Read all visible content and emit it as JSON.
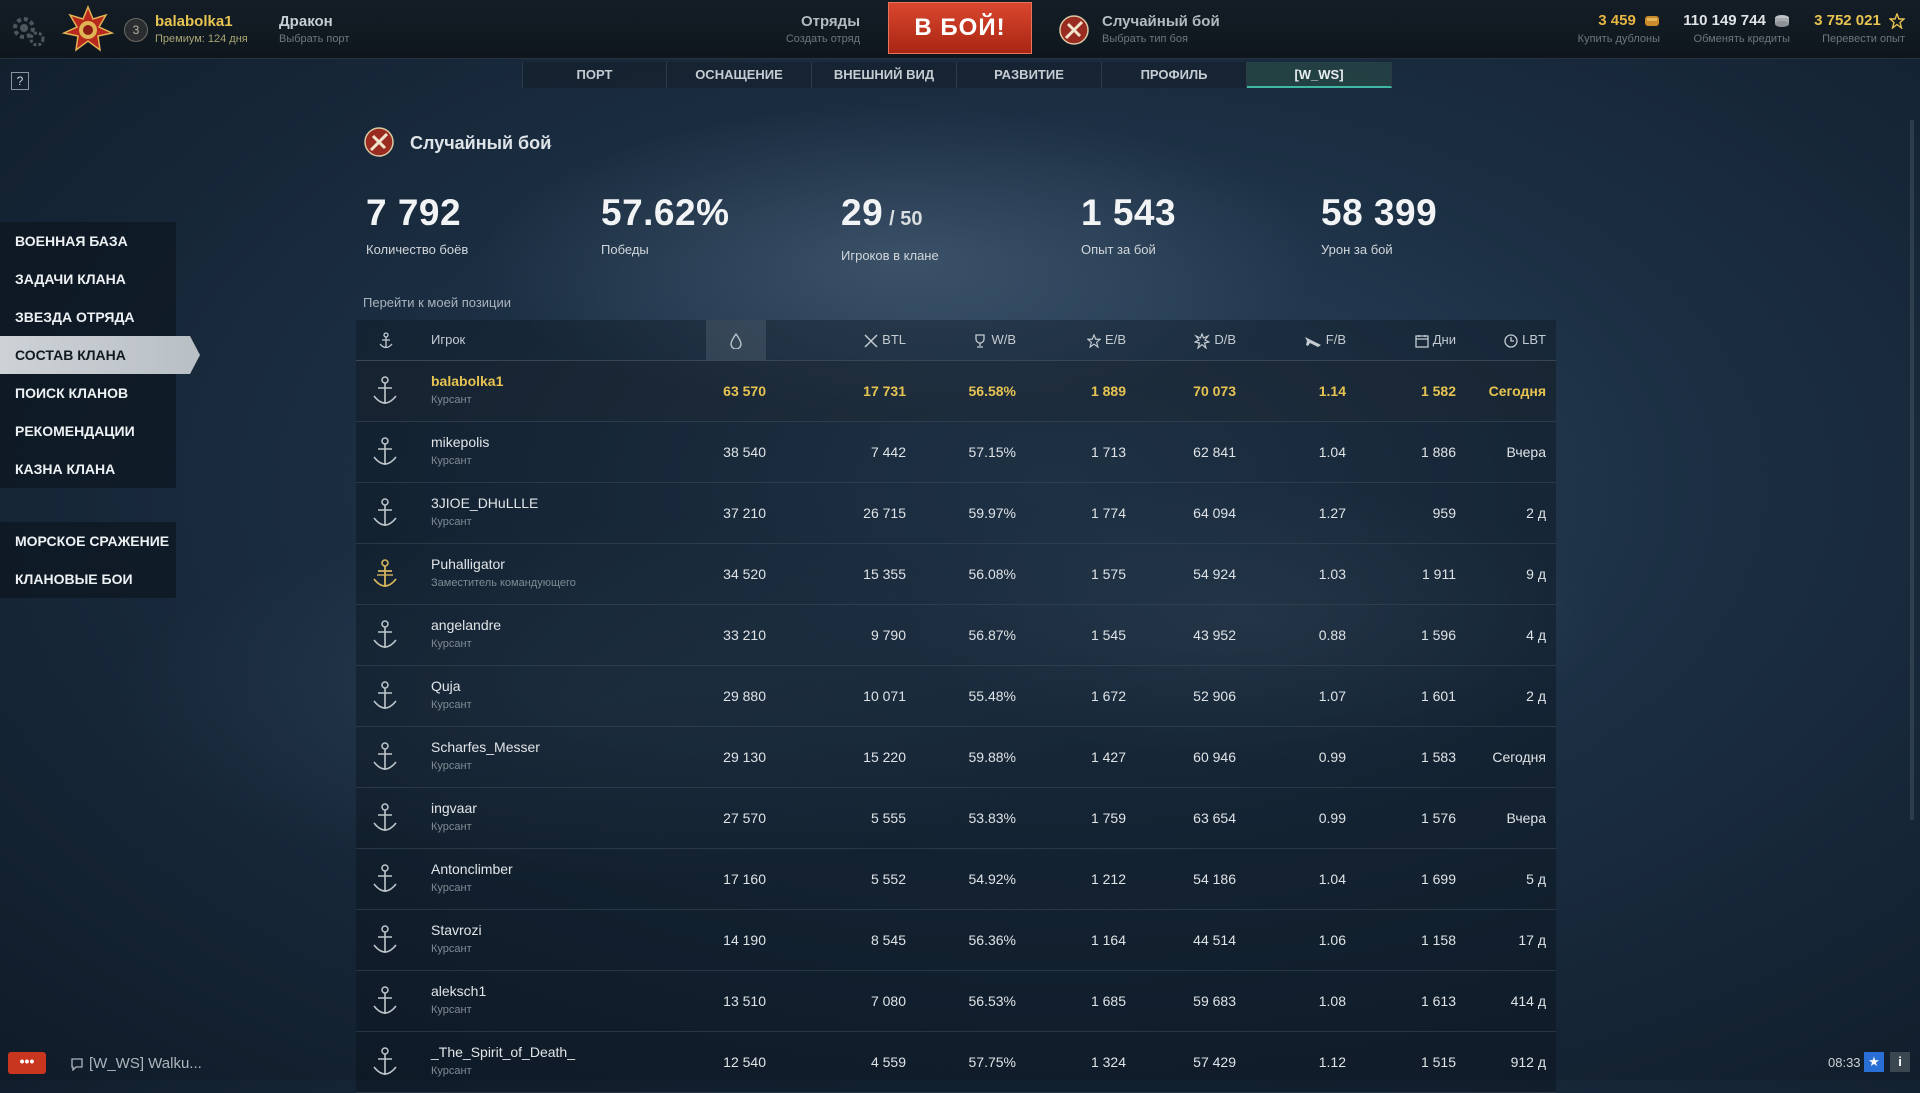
{
  "topbar": {
    "username": "balabolka1",
    "premium": "Премиум: 124 дня",
    "level": "3",
    "ship_name": "Дракон",
    "ship_sub": "Выбрать порт",
    "squad_label": "Отряды",
    "squad_sub": "Создать отряд",
    "battle_label": "В БОЙ!",
    "mode_label": "Случайный бой",
    "mode_sub": "Выбрать тип боя",
    "currencies": [
      {
        "value": "3 459",
        "label": "Купить дублоны",
        "color": "#e7b544",
        "icon": "doubloon-icon"
      },
      {
        "value": "110 149 744",
        "label": "Обменять кредиты",
        "color": "#dfe3e6",
        "icon": "credits-icon"
      },
      {
        "value": "3 752 021",
        "label": "Перевести опыт",
        "color": "#e7c452",
        "icon": "star-icon"
      }
    ]
  },
  "help_label": "?",
  "tabs": [
    {
      "label": "ПОРТ",
      "active": false
    },
    {
      "label": "ОСНАЩЕНИЕ",
      "active": false
    },
    {
      "label": "ВНЕШНИЙ ВИД",
      "active": false
    },
    {
      "label": "РАЗВИТИЕ",
      "active": false
    },
    {
      "label": "ПРОФИЛЬ",
      "active": false
    },
    {
      "label": "[W_WS]",
      "active": true
    }
  ],
  "sidebar": {
    "group1": [
      {
        "label": "ВОЕННАЯ БАЗА",
        "active": false
      },
      {
        "label": "ЗАДАЧИ КЛАНА",
        "active": false
      },
      {
        "label": "ЗВЕЗДА ОТРЯДА",
        "active": false
      },
      {
        "label": "СОСТАВ КЛАНА",
        "active": true
      },
      {
        "label": "ПОИСК КЛАНОВ",
        "active": false
      },
      {
        "label": "РЕКОМЕНДАЦИИ",
        "active": false
      },
      {
        "label": "КАЗНА КЛАНА",
        "active": false
      }
    ],
    "group2": [
      {
        "label": "МОРСКОЕ СРАЖЕНИЕ",
        "active": false
      },
      {
        "label": "КЛАНОВЫЕ БОИ",
        "active": false
      }
    ]
  },
  "mode_header": {
    "title": "Случайный бой",
    "arrow": "↓"
  },
  "stats": [
    {
      "value": "7 792",
      "suffix": "",
      "label": "Количество боёв"
    },
    {
      "value": "57.62%",
      "suffix": "",
      "label": "Победы"
    },
    {
      "value": "29",
      "suffix": "/ 50",
      "label": "Игроков в клане"
    },
    {
      "value": "1 543",
      "suffix": "",
      "label": "Опыт за бой"
    },
    {
      "value": "58 399",
      "suffix": "",
      "label": "Урон за бой"
    }
  ],
  "goto_label": "Перейти к моей позиции",
  "table": {
    "columns": [
      {
        "key": "rank",
        "label": "",
        "icon": "anchor-icon"
      },
      {
        "key": "player",
        "label": "Игрок",
        "icon": ""
      },
      {
        "key": "oil",
        "label": "",
        "icon": "oil-drop-icon"
      },
      {
        "key": "btl",
        "label": "BTL",
        "icon": "crossed-swords-icon"
      },
      {
        "key": "wb",
        "label": "W/B",
        "icon": "trophy-icon"
      },
      {
        "key": "eb",
        "label": "E/B",
        "icon": "star-icon"
      },
      {
        "key": "db",
        "label": "D/B",
        "icon": "explosion-icon"
      },
      {
        "key": "fb",
        "label": "F/B",
        "icon": "plane-icon"
      },
      {
        "key": "days",
        "label": "Дни",
        "icon": "calendar-icon"
      },
      {
        "key": "lbt",
        "label": "LBT",
        "icon": "clock-icon"
      }
    ],
    "rows": [
      {
        "name": "balabolka1",
        "role": "Курсант",
        "oil": "63 570",
        "btl": "17 731",
        "wb": "56.58%",
        "eb": "1 889",
        "db": "70 073",
        "fb": "1.14",
        "days": "1 582",
        "lbt": "Сегодня",
        "me": true,
        "officer": false
      },
      {
        "name": "mikepolis",
        "role": "Курсант",
        "oil": "38 540",
        "btl": "7 442",
        "wb": "57.15%",
        "eb": "1 713",
        "db": "62 841",
        "fb": "1.04",
        "days": "1 886",
        "lbt": "Вчера",
        "me": false,
        "officer": false
      },
      {
        "name": "3JIOE_DHuLLLE",
        "role": "Курсант",
        "oil": "37 210",
        "btl": "26 715",
        "wb": "59.97%",
        "eb": "1 774",
        "db": "64 094",
        "fb": "1.27",
        "days": "959",
        "lbt": "2 д",
        "me": false,
        "officer": false
      },
      {
        "name": "Puhalligator",
        "role": "Заместитель командующего",
        "oil": "34 520",
        "btl": "15 355",
        "wb": "56.08%",
        "eb": "1 575",
        "db": "54 924",
        "fb": "1.03",
        "days": "1 911",
        "lbt": "9 д",
        "me": false,
        "officer": true
      },
      {
        "name": "angelandre",
        "role": "Курсант",
        "oil": "33 210",
        "btl": "9 790",
        "wb": "56.87%",
        "eb": "1 545",
        "db": "43 952",
        "fb": "0.88",
        "days": "1 596",
        "lbt": "4 д",
        "me": false,
        "officer": false
      },
      {
        "name": "Quja",
        "role": "Курсант",
        "oil": "29 880",
        "btl": "10 071",
        "wb": "55.48%",
        "eb": "1 672",
        "db": "52 906",
        "fb": "1.07",
        "days": "1 601",
        "lbt": "2 д",
        "me": false,
        "officer": false
      },
      {
        "name": "Scharfes_Messer",
        "role": "Курсант",
        "oil": "29 130",
        "btl": "15 220",
        "wb": "59.88%",
        "eb": "1 427",
        "db": "60 946",
        "fb": "0.99",
        "days": "1 583",
        "lbt": "Сегодня",
        "me": false,
        "officer": false
      },
      {
        "name": "ingvaar",
        "role": "Курсант",
        "oil": "27 570",
        "btl": "5 555",
        "wb": "53.83%",
        "eb": "1 759",
        "db": "63 654",
        "fb": "0.99",
        "days": "1 576",
        "lbt": "Вчера",
        "me": false,
        "officer": false
      },
      {
        "name": "Antonclimber",
        "role": "Курсант",
        "oil": "17 160",
        "btl": "5 552",
        "wb": "54.92%",
        "eb": "1 212",
        "db": "54 186",
        "fb": "1.04",
        "days": "1 699",
        "lbt": "5 д",
        "me": false,
        "officer": false
      },
      {
        "name": "Stavrozi",
        "role": "Курсант",
        "oil": "14 190",
        "btl": "8 545",
        "wb": "56.36%",
        "eb": "1 164",
        "db": "44 514",
        "fb": "1.06",
        "days": "1 158",
        "lbt": "17 д",
        "me": false,
        "officer": false
      },
      {
        "name": "aleksch1",
        "role": "Курсант",
        "oil": "13 510",
        "btl": "7 080",
        "wb": "56.53%",
        "eb": "1 685",
        "db": "59 683",
        "fb": "1.08",
        "days": "1 613",
        "lbt": "414 д",
        "me": false,
        "officer": false
      },
      {
        "name": "_The_Spirit_of_Death_",
        "role": "Курсант",
        "oil": "12 540",
        "btl": "4 559",
        "wb": "57.75%",
        "eb": "1 324",
        "db": "57 429",
        "fb": "1.12",
        "days": "1 515",
        "lbt": "912 д",
        "me": false,
        "officer": false
      }
    ]
  },
  "bottom": {
    "chat_button": "•••",
    "chat_channel": "[W_WS] Walku...",
    "clock": "08:33",
    "star_btn": "★",
    "info_btn": "i"
  },
  "colors": {
    "accent_gold": "#e7c452",
    "battle_red": "#c9361f",
    "active_tab": "#3fb8a4"
  }
}
